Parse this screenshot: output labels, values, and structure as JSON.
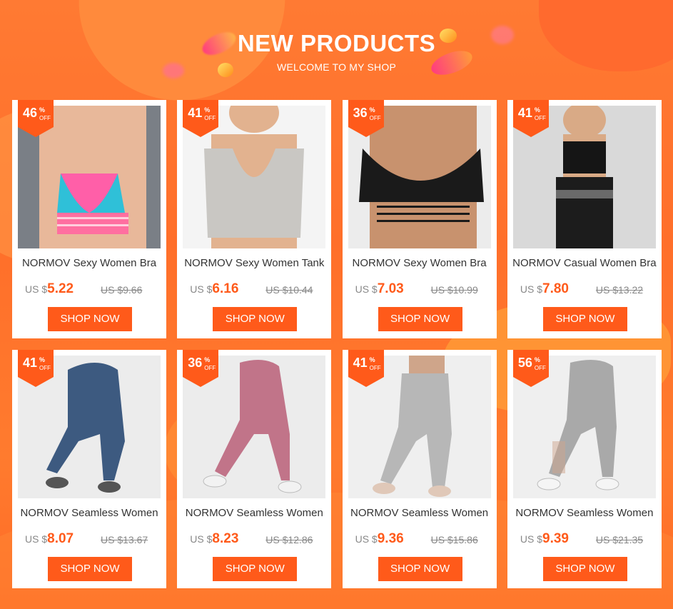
{
  "header": {
    "title": "NEW PRODUCTS",
    "subtitle": "WELCOME TO MY SHOP"
  },
  "colors": {
    "accent": "#ff5a1a",
    "background": "#ff7a33",
    "card": "#ffffff"
  },
  "products": [
    {
      "discount": "46",
      "pct": "%",
      "off": "OFF",
      "name": "NORMOV Sexy Women Bra",
      "currency": "US $",
      "price": "5.22",
      "old_price": "US $9.66",
      "button": "SHOP NOW",
      "image": "pink-floral-bra-photo"
    },
    {
      "discount": "41",
      "pct": "%",
      "off": "OFF",
      "name": "NORMOV Sexy Women Tank",
      "currency": "US $",
      "price": "6.16",
      "old_price": "US $10.44",
      "button": "SHOP NOW",
      "image": "grey-tank-top-photo"
    },
    {
      "discount": "36",
      "pct": "%",
      "off": "OFF",
      "name": "NORMOV Sexy Women Bra",
      "currency": "US $",
      "price": "7.03",
      "old_price": "US $10.99",
      "button": "SHOP NOW",
      "image": "black-strappy-bra-photo"
    },
    {
      "discount": "41",
      "pct": "%",
      "off": "OFF",
      "name": "NORMOV Casual Women Bra",
      "currency": "US $",
      "price": "7.80",
      "old_price": "US $13.22",
      "button": "SHOP NOW",
      "image": "black-sports-set-photo"
    },
    {
      "discount": "41",
      "pct": "%",
      "off": "OFF",
      "name": "NORMOV Seamless Women",
      "currency": "US $",
      "price": "8.07",
      "old_price": "US $13.67",
      "button": "SHOP NOW",
      "image": "blue-leggings-photo"
    },
    {
      "discount": "36",
      "pct": "%",
      "off": "OFF",
      "name": "NORMOV Seamless Women",
      "currency": "US $",
      "price": "8.23",
      "old_price": "US $12.86",
      "button": "SHOP NOW",
      "image": "pink-leggings-photo"
    },
    {
      "discount": "41",
      "pct": "%",
      "off": "OFF",
      "name": "NORMOV Seamless Women",
      "currency": "US $",
      "price": "9.36",
      "old_price": "US $15.86",
      "button": "SHOP NOW",
      "image": "grey-leggings-photo"
    },
    {
      "discount": "56",
      "pct": "%",
      "off": "OFF",
      "name": "NORMOV Seamless Women",
      "currency": "US $",
      "price": "9.39",
      "old_price": "US $21.35",
      "button": "SHOP NOW",
      "image": "grey-mesh-leggings-photo"
    }
  ]
}
